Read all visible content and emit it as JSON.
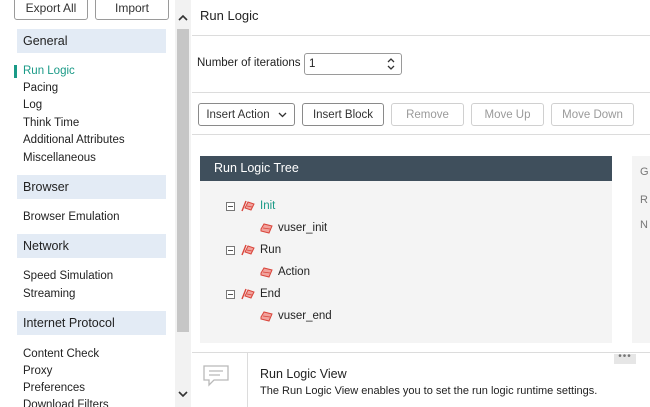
{
  "sidebar": {
    "export_all_label": "Export All",
    "import_label": "Import",
    "groups": {
      "general": {
        "label": "General",
        "items": [
          "Run Logic",
          "Pacing",
          "Log",
          "Think Time",
          "Additional Attributes",
          "Miscellaneous"
        ]
      },
      "browser": {
        "label": "Browser",
        "items": [
          "Browser Emulation"
        ]
      },
      "network": {
        "label": "Network",
        "items": [
          "Speed Simulation",
          "Streaming"
        ]
      },
      "internet_protocol": {
        "label": "Internet Protocol",
        "items": [
          "Content Check",
          "Proxy",
          "Preferences",
          "Download Filters"
        ]
      }
    },
    "active_item": "Run Logic"
  },
  "main": {
    "title": "Run Logic",
    "iterations": {
      "label": "Number of iterations",
      "value": "1"
    },
    "toolbar": {
      "insert_action": "Insert Action",
      "insert_block": "Insert Block",
      "remove": "Remove",
      "move_up": "Move Up",
      "move_down": "Move Down"
    },
    "tree": {
      "header": "Run Logic Tree",
      "nodes": [
        {
          "label": "Init",
          "child": "vuser_init",
          "selected": true
        },
        {
          "label": "Run",
          "child": "Action",
          "selected": false
        },
        {
          "label": "End",
          "child": "vuser_end",
          "selected": false
        }
      ]
    },
    "right_panel": {
      "letters": [
        "G",
        "R",
        "N"
      ]
    },
    "info": {
      "title": "Run Logic View",
      "description": "The Run Logic View enables you to set the run logic runtime settings."
    }
  },
  "colors": {
    "accent": "#1a9a87",
    "tree_header": "#3f4f5c",
    "group_header_bg": "#e3ebf5",
    "icon_red": "#d9443a"
  },
  "icons": {
    "scroll_up": "chevron-up-icon",
    "scroll_down": "chevron-down-icon",
    "dropdown": "chevron-down-icon",
    "spinner": "up-down-spinner-icon",
    "block": "block-group-icon",
    "action": "action-icon",
    "info": "speech-bubble-icon"
  }
}
